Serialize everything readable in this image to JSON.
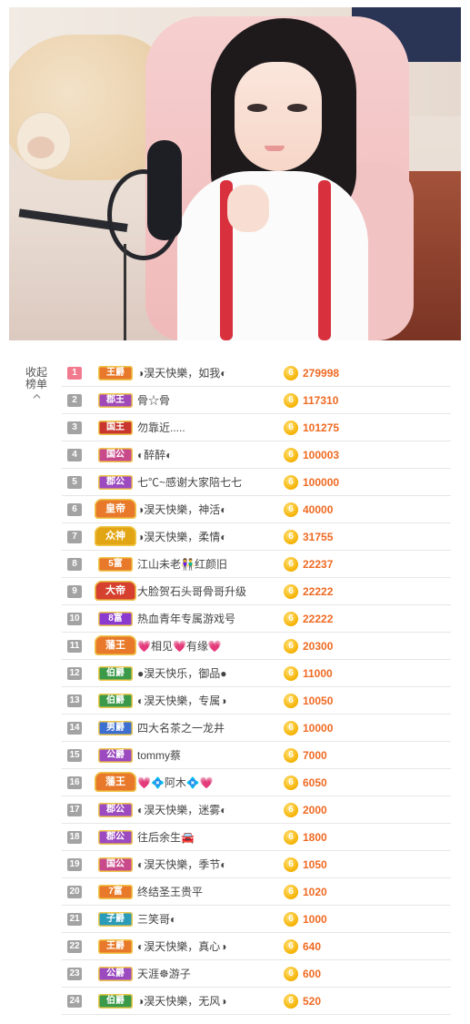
{
  "ranking": {
    "collapse_label": "收起榜单",
    "collapse_icon": "chevron-up-icon",
    "coin_symbol": "6",
    "rows": [
      {
        "rank": "1",
        "badge": "王爵",
        "badge_color": "#e8792a",
        "name": "◑淏天快樂，如我◐",
        "score": "279998"
      },
      {
        "rank": "2",
        "badge": "郡王",
        "badge_color": "#a04ab8",
        "name": "骨☆骨",
        "score": "117310"
      },
      {
        "rank": "3",
        "badge": "国王",
        "badge_color": "#c8362e",
        "name": "勿靠近.....",
        "score": "101275"
      },
      {
        "rank": "4",
        "badge": "国公",
        "badge_color": "#c94a8b",
        "name": "◐醉醉◐",
        "score": "100003"
      },
      {
        "rank": "5",
        "badge": "郡公",
        "badge_color": "#9b4ac0",
        "name": "七℃~感谢大家陪七七",
        "score": "100000"
      },
      {
        "rank": "6",
        "badge": "皇帝",
        "badge_color": "#e8792a",
        "name": "◑淏天快樂，神活◐",
        "score": "40000"
      },
      {
        "rank": "7",
        "badge": "众神",
        "badge_color": "#e2a514",
        "name": "◑淏天快樂，柔情◐",
        "score": "31755"
      },
      {
        "rank": "8",
        "badge": "5富",
        "badge_color": "#e8792a",
        "name": "江山未老👫红颜旧",
        "score": "22237"
      },
      {
        "rank": "9",
        "badge": "大帝",
        "badge_color": "#d6402e",
        "name": "大脸贺石头哥骨哥升级",
        "score": "22222"
      },
      {
        "rank": "10",
        "badge": "8富",
        "badge_color": "#8b3ad0",
        "name": "热血青年专属游戏号",
        "score": "22222"
      },
      {
        "rank": "11",
        "badge": "藩王",
        "badge_color": "#e8792a",
        "name": "💗相见💗有缘💗",
        "score": "20300"
      },
      {
        "rank": "12",
        "badge": "伯爵",
        "badge_color": "#3a9a4a",
        "name": "●淏天快乐，御品●",
        "score": "11000"
      },
      {
        "rank": "13",
        "badge": "伯爵",
        "badge_color": "#3a9a4a",
        "name": "◐淏天快樂，专属◑",
        "score": "10050"
      },
      {
        "rank": "14",
        "badge": "男爵",
        "badge_color": "#3d6fd1",
        "name": "四大名茶之一龙井",
        "score": "10000"
      },
      {
        "rank": "15",
        "badge": "公爵",
        "badge_color": "#9b4ac0",
        "name": "tommy蔡",
        "score": "7000"
      },
      {
        "rank": "16",
        "badge": "藩王",
        "badge_color": "#e8792a",
        "name": "💗💠阿木💠💗",
        "score": "6050"
      },
      {
        "rank": "17",
        "badge": "郡公",
        "badge_color": "#9b4ac0",
        "name": "◐淏天快樂，迷雾◐",
        "score": "2000"
      },
      {
        "rank": "18",
        "badge": "郡公",
        "badge_color": "#9b4ac0",
        "name": "往后余生🚘",
        "score": "1800"
      },
      {
        "rank": "19",
        "badge": "国公",
        "badge_color": "#c94a8b",
        "name": "◐淏天快樂，季节◐",
        "score": "1050"
      },
      {
        "rank": "20",
        "badge": "7富",
        "badge_color": "#e8792a",
        "name": "终结圣王贵平",
        "score": "1020"
      },
      {
        "rank": "21",
        "badge": "子爵",
        "badge_color": "#2a9bb8",
        "name": "三笑哥◐",
        "score": "1000"
      },
      {
        "rank": "22",
        "badge": "王爵",
        "badge_color": "#e8792a",
        "name": "◐淏天快樂，真心◑",
        "score": "640"
      },
      {
        "rank": "23",
        "badge": "公爵",
        "badge_color": "#9b4ac0",
        "name": "天涯☸游子",
        "score": "600"
      },
      {
        "rank": "24",
        "badge": "伯爵",
        "badge_color": "#3a9a4a",
        "name": "◑淏天快樂，无风◑",
        "score": "520"
      }
    ]
  }
}
